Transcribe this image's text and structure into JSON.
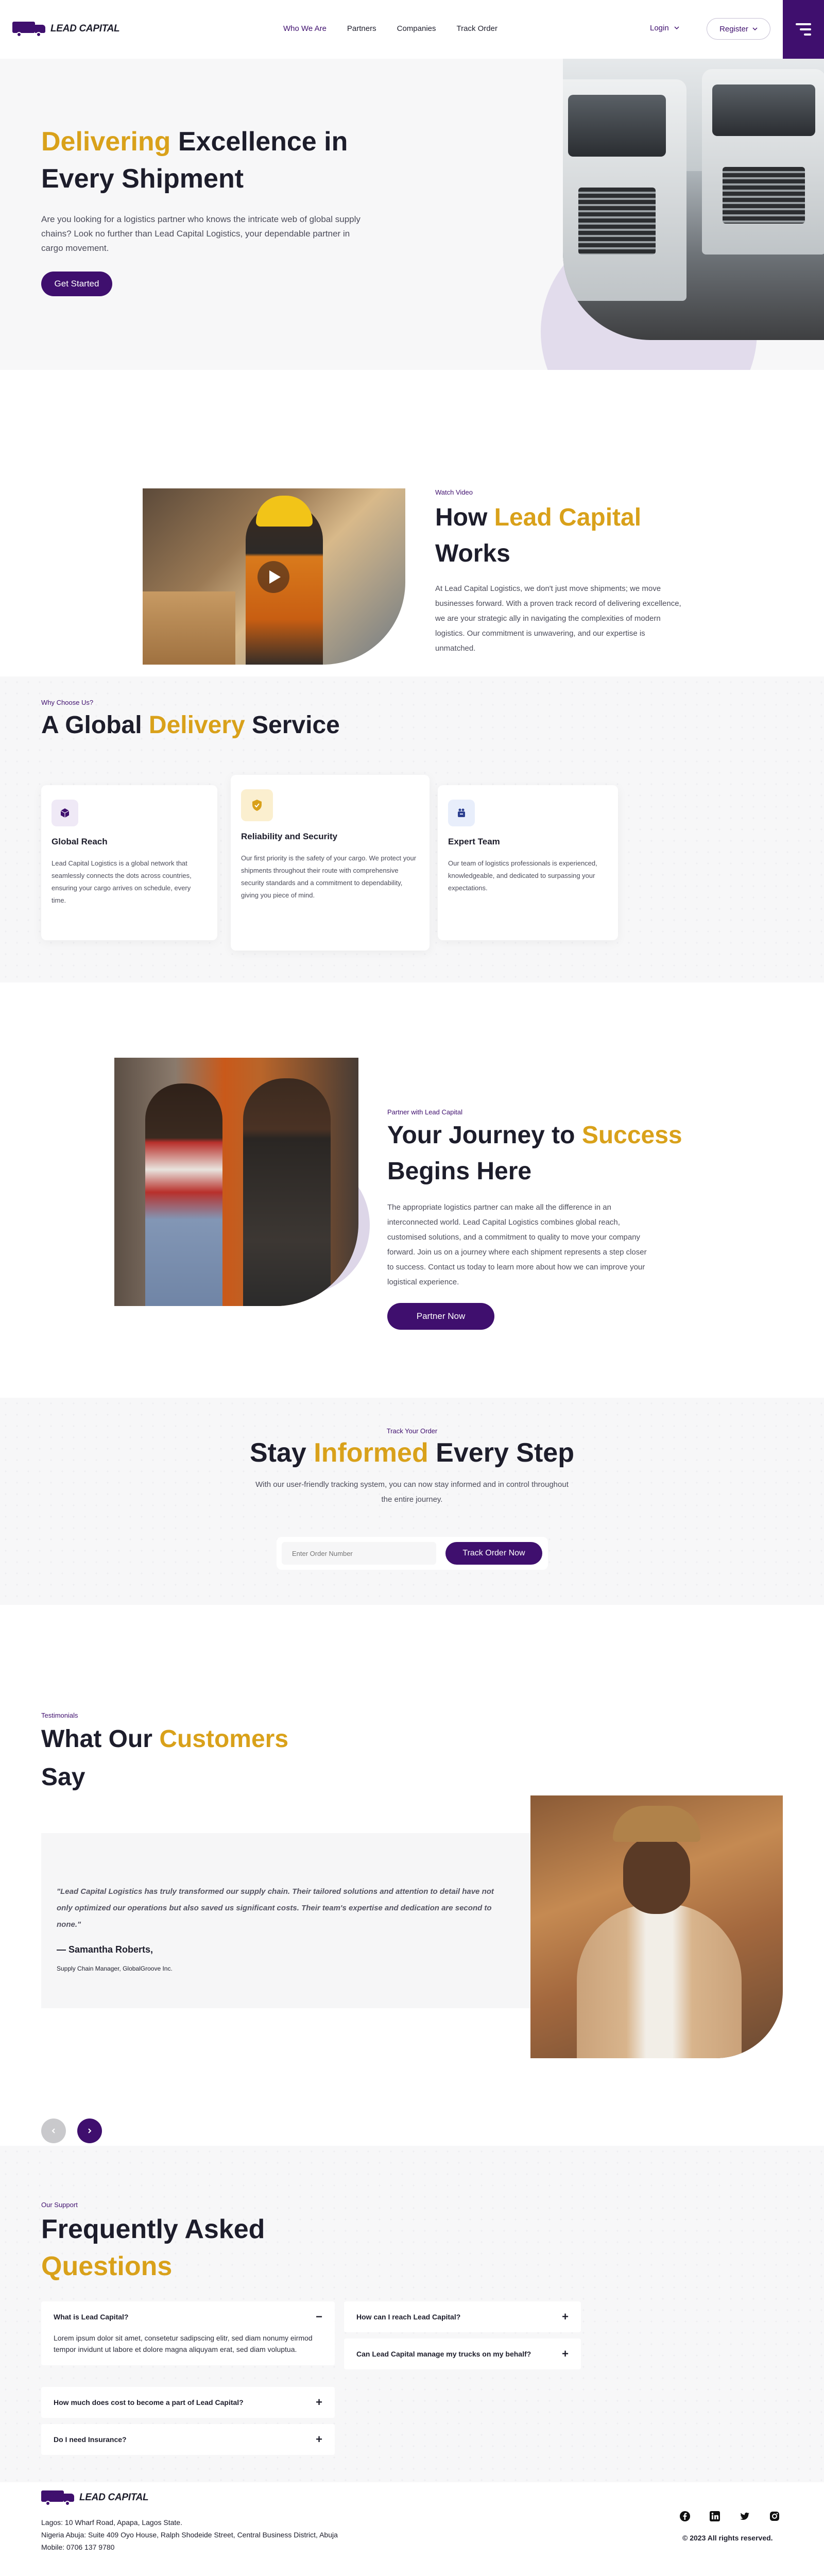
{
  "brand": {
    "name": "LEAD CAPITAL"
  },
  "nav": {
    "links": [
      "Who We Are",
      "Partners",
      "Companies",
      "Track Order"
    ],
    "login": "Login",
    "register": "Register"
  },
  "hero": {
    "title_highlight": "Delivering",
    "title_rest": " Excellence in Every Shipment",
    "body": "Are you looking for a logistics partner who knows the intricate web of global supply chains? Look no further than Lead Capital Logistics, your dependable partner in cargo movement.",
    "cta": "Get Started"
  },
  "how": {
    "eyebrow": "Watch Video",
    "title_a": "How ",
    "title_highlight": "Lead Capital",
    "title_b": " Works",
    "body": "At Lead Capital Logistics, we don't just move shipments; we move businesses forward. With a proven track record of delivering excellence, we are your strategic ally in navigating the complexities of modern logistics. Our commitment is unwavering, and our expertise is unmatched."
  },
  "why": {
    "eyebrow": "Why Choose Us?",
    "title_a": "A Global ",
    "title_highlight": "Delivery",
    "title_b": " Service",
    "cards": [
      {
        "title": "Global Reach",
        "body": "Lead Capital Logistics is a global network that seamlessly connects the dots across countries, ensuring your cargo arrives on schedule, every time.",
        "icon": "cube-icon",
        "color": "#efe9f6",
        "icon_color": "#3f0f6e"
      },
      {
        "title": "Reliability and Security",
        "body": "Our first priority is the safety of your cargo. We protect your shipments throughout their route with comprehensive security standards and a commitment to dependability, giving you piece of mind.",
        "icon": "shield-icon",
        "color": "#fbefcf",
        "icon_color": "#d9a11a"
      },
      {
        "title": "Expert Team",
        "body": "Our team of logistics professionals is experienced, knowledgeable, and dedicated to surpassing your expectations.",
        "icon": "team-icon",
        "color": "#e8eefb",
        "icon_color": "#2b3f8f"
      }
    ]
  },
  "journey": {
    "eyebrow": "Partner with Lead Capital",
    "title_a": "Your Journey to ",
    "title_highlight": "Success",
    "title_b": " Begins Here",
    "body": "The appropriate logistics partner can make all the difference in an interconnected world. Lead Capital Logistics combines global reach, customised solutions, and a commitment to quality to move your company forward. Join us on a journey where each shipment represents a step closer to success. Contact us today to learn more about how we can improve your logistical experience.",
    "cta": "Partner Now"
  },
  "track": {
    "eyebrow": "Track Your Order",
    "title_a": "Stay ",
    "title_highlight": "Informed",
    "title_b": " Every Step",
    "body": "With our user-friendly tracking system, you can now stay informed and in control throughout the entire journey.",
    "placeholder": "Enter Order Number",
    "cta": "Track Order Now"
  },
  "testimonials": {
    "eyebrow": "Testimonials",
    "title_a": "What Our ",
    "title_highlight": "Customers",
    "title_b": " Say",
    "quote": "\"Lead Capital Logistics has truly transformed our supply chain. Their tailored solutions and attention to detail have not only optimized our operations but also saved us significant costs. Their team's expertise and dedication are second to none.\"",
    "name": "— Samantha Roberts,",
    "role": "Supply Chain Manager, GlobalGroove Inc."
  },
  "faq": {
    "eyebrow": "Our Support",
    "title_a": "Frequently Asked ",
    "title_highlight": "Questions",
    "items_left": [
      {
        "q": "What is Lead Capital?",
        "a": "Lorem ipsum dolor sit amet, consetetur sadipscing elitr, sed diam nonumy eirmod tempor invidunt ut labore et dolore magna aliquyam erat, sed diam voluptua.",
        "open": true
      },
      {
        "q": "How much does cost to become a part of Lead Capital?",
        "open": false
      },
      {
        "q": "Do I need Insurance?",
        "open": false
      }
    ],
    "items_right": [
      {
        "q": "How can I reach Lead Capital?",
        "open": false
      },
      {
        "q": "Can Lead Capital manage my trucks on my behalf?",
        "open": false
      }
    ]
  },
  "footer": {
    "address_lines": [
      "Lagos: 10 Wharf Road, Apapa, Lagos State.",
      "Nigeria Abuja: Suite 409 Oyo House, Ralph Shodeide Street, Central Business District, Abuja",
      "Mobile: 0706 137 9780"
    ],
    "socials": [
      "facebook-icon",
      "linkedin-icon",
      "twitter-icon",
      "instagram-icon"
    ],
    "copyright": "© 2023 All rights reserved."
  },
  "colors": {
    "primary": "#3f0f6e",
    "accent": "#d9a11a"
  }
}
